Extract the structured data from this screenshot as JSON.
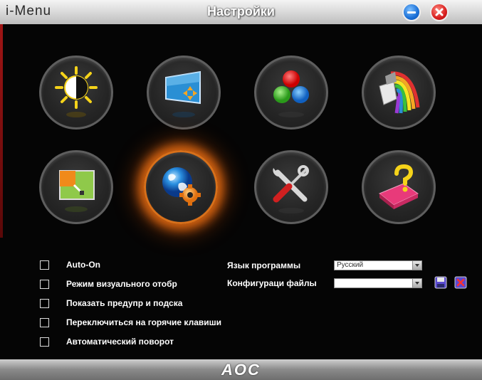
{
  "window": {
    "brand": "i-Menu",
    "title": "Настройки",
    "footer_logo": "AOC"
  },
  "icons": [
    {
      "name": "brightness-contrast-icon",
      "active": false
    },
    {
      "name": "image-setup-icon",
      "active": false
    },
    {
      "name": "color-setup-icon",
      "active": false
    },
    {
      "name": "picture-boost-icon",
      "active": false
    },
    {
      "name": "osd-setup-icon",
      "active": false
    },
    {
      "name": "extra-settings-icon",
      "active": true
    },
    {
      "name": "tools-icon",
      "active": false
    },
    {
      "name": "help-icon",
      "active": false
    }
  ],
  "options": [
    {
      "label": "Auto-On",
      "checked": false
    },
    {
      "label": "Режим визуального отобр",
      "checked": false
    },
    {
      "label": "Показать предупр и подска",
      "checked": false
    },
    {
      "label": "Переключиться на горячие клавиши",
      "checked": false
    },
    {
      "label": "Автоматический поворот",
      "checked": false
    }
  ],
  "settings": {
    "language_label": "Язык программы",
    "language_value": "Русский",
    "config_label": "Конфигураци файлы",
    "config_value": ""
  },
  "colors": {
    "accent_glow": "#ff7814",
    "background": "#050505"
  }
}
